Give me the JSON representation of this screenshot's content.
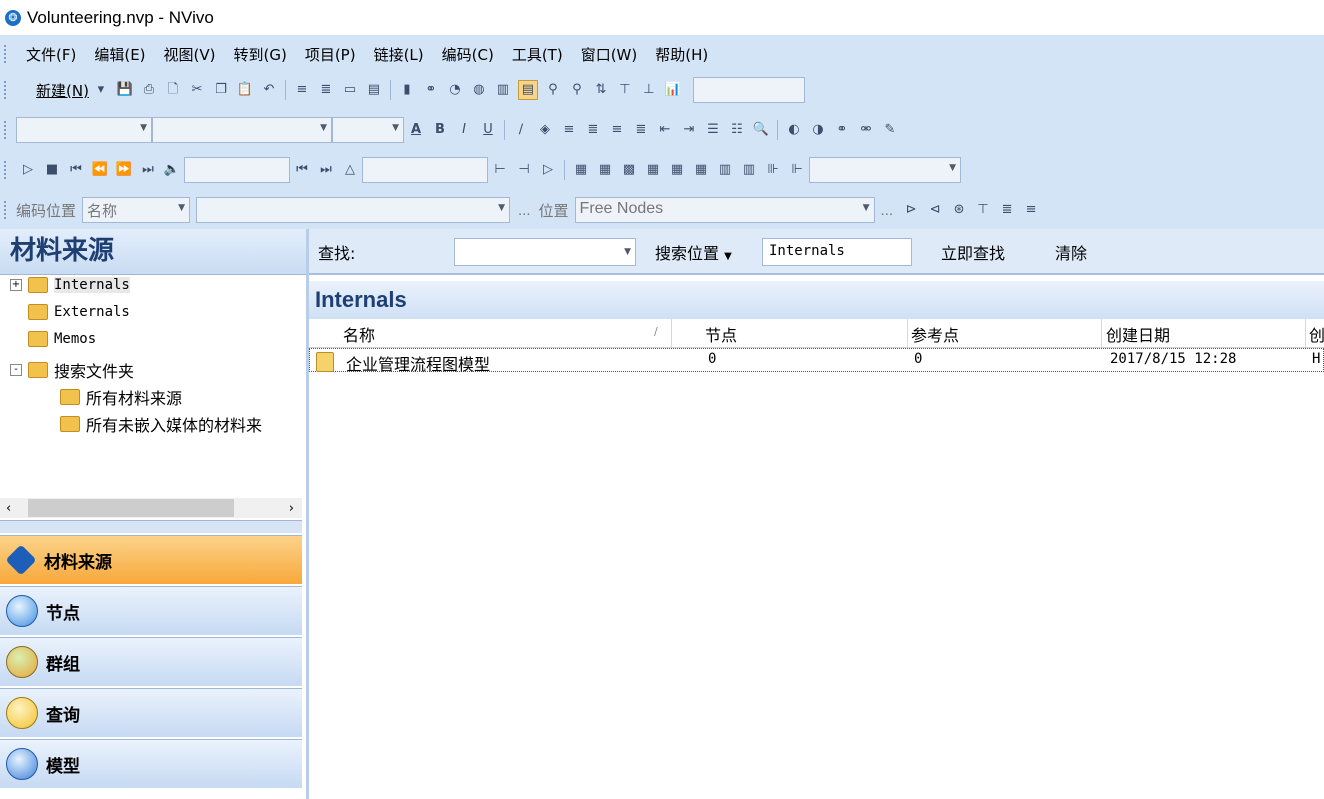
{
  "window": {
    "title": "Volunteering.nvp - NVivo"
  },
  "menu": [
    "文件(F)",
    "编辑(E)",
    "视图(V)",
    "转到(G)",
    "项目(P)",
    "链接(L)",
    "编码(C)",
    "工具(T)",
    "窗口(W)",
    "帮助(H)"
  ],
  "toolbar1": {
    "new_label": "新建(N)"
  },
  "toolbar5": {
    "coding_position_label": "编码位置",
    "name_placeholder": "名称",
    "location_label": "位置",
    "location_value": "Free Nodes",
    "ellipsis1": "...",
    "ellipsis2": "..."
  },
  "left": {
    "header": "材料来源",
    "tree": [
      {
        "label": "Internals",
        "expander": "+"
      },
      {
        "label": "Externals"
      },
      {
        "label": "Memos"
      },
      {
        "label": "搜索文件夹",
        "expander": "-"
      },
      {
        "label": "所有材料来源"
      },
      {
        "label": "所有未嵌入媒体的材料来"
      }
    ],
    "nav": [
      {
        "label": "材料来源",
        "selected": true,
        "color": "#1d5fb8"
      },
      {
        "label": "节点",
        "color": "#3d8fe0"
      },
      {
        "label": "群组",
        "color": "#e6a43a"
      },
      {
        "label": "查询",
        "color": "#f0c030"
      },
      {
        "label": "模型",
        "color": "#3b7fd8"
      }
    ]
  },
  "find": {
    "label": "查找:",
    "search_in_label": "搜索位置",
    "search_in_value": "Internals",
    "find_now": "立即查找",
    "clear": "清除"
  },
  "list": {
    "title": "Internals",
    "columns": [
      "名称",
      "节点",
      "参考点",
      "创建日期",
      "创"
    ],
    "rows": [
      {
        "name": "企业管理流程图模型",
        "nodes": "0",
        "refs": "0",
        "created": "2017/8/15 12:28",
        "extra": "H"
      }
    ]
  }
}
